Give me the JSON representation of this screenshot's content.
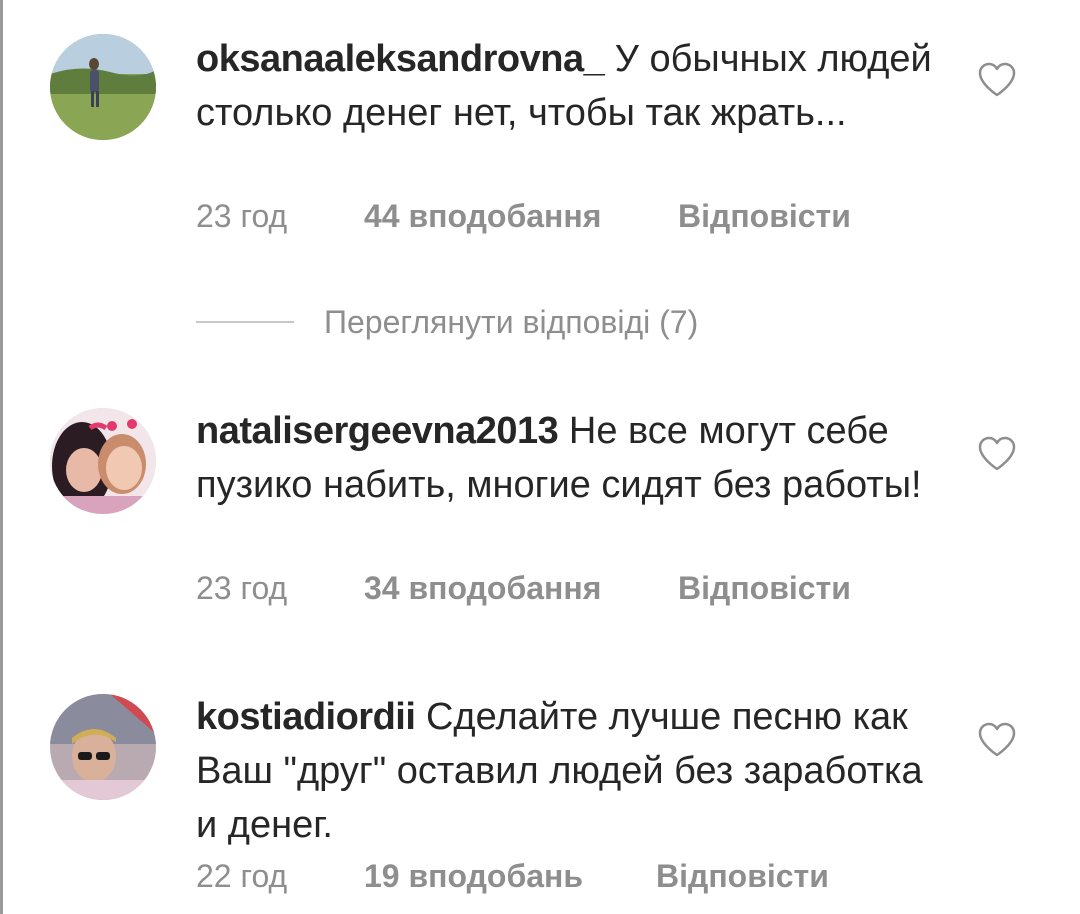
{
  "comments": [
    {
      "username": "oksanaaleksandrovna_",
      "text": "У обычных людей столько денег нет, чтобы так жрать...",
      "time": "23 год",
      "likes": "44 вподобання",
      "reply": "Відповісти",
      "avatar_icon": "avatar-photo-woman-field",
      "like_icon": "heart-outline-icon"
    },
    {
      "username": "natalisergeevna2013",
      "text": "Не все могут себе пузико набить, многие сидят без работы!",
      "time": "23 год",
      "likes": "34 вподобання",
      "reply": "Відповісти",
      "avatar_icon": "avatar-photo-two-girls",
      "like_icon": "heart-outline-icon"
    },
    {
      "username": "kostiadiordii",
      "text": "Сделайте лучше песню как Ваш \"друг\" оставил людей без заработка и денег.",
      "time": "22 год",
      "likes": "19 вподобань",
      "reply": "Відповісти",
      "avatar_icon": "avatar-photo-man-sunglasses",
      "like_icon": "heart-outline-icon"
    }
  ],
  "view_replies": {
    "label": "Переглянути відповіді (7)"
  },
  "colors": {
    "text": "#262626",
    "secondary": "#8e8e8e",
    "divider": "#c7c7c7"
  }
}
